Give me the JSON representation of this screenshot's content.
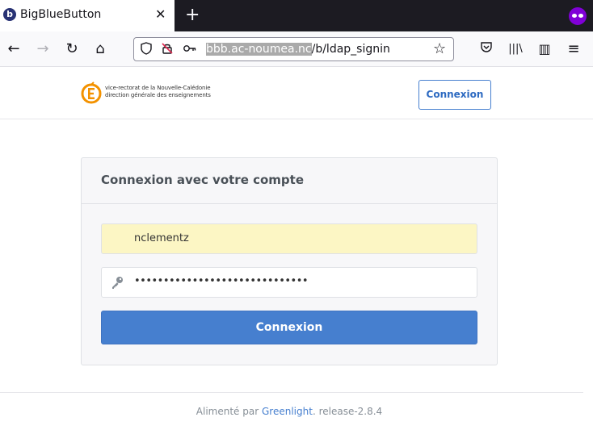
{
  "browser": {
    "tab": {
      "title": "BigBlueButton",
      "favicon_glyph": "b",
      "close_glyph": "✕"
    },
    "new_tab_glyph": "+",
    "url": {
      "host": "bbb.ac-noumea.nc",
      "path": "/b/ldap_signin"
    },
    "nav": {
      "back": "←",
      "forward": "→",
      "reload": "↻",
      "home": "⌂",
      "star": "☆"
    },
    "toolbar": {
      "pocket": "◡",
      "library": "|||\\",
      "sidebar": "▥",
      "menu": "≡"
    }
  },
  "header": {
    "logo_line1": "vice-rectorat de la Nouvelle-Calédonie",
    "logo_line2": "direction générale des enseignements",
    "login_label": "Connexion"
  },
  "form": {
    "title": "Connexion avec votre compte",
    "username_value": "nclementz",
    "password_dots": "••••••••••••••••••••••••••••••",
    "submit_label": "Connexion"
  },
  "footer": {
    "prefix": "Alimenté par",
    "link": "Greenlight",
    "suffix": ". release-2.8.4"
  },
  "colors": {
    "accent": "#467fcf",
    "autofill": "#fcf6c4",
    "private": "#8000d7",
    "logo_orange": "#f39200"
  }
}
